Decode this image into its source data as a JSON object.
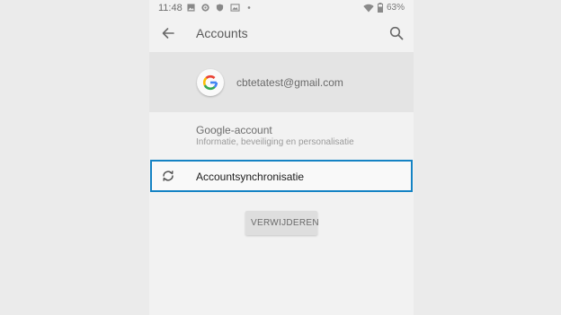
{
  "status_bar": {
    "time": "11:48",
    "battery": "63%"
  },
  "app_bar": {
    "title": "Accounts"
  },
  "account": {
    "email": "cbtetatest@gmail.com"
  },
  "google_account": {
    "title": "Google-account",
    "subtitle": "Informatie, beveiliging en personalisatie"
  },
  "sync": {
    "label": "Accountsynchronisatie"
  },
  "actions": {
    "remove_label": "VERWIJDEREN"
  },
  "colors": {
    "highlight": "#1583c4",
    "background": "#f2f2f2"
  }
}
